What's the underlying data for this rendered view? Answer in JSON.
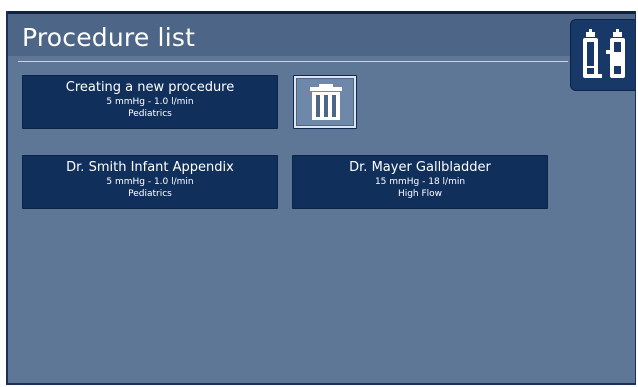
{
  "header": {
    "title": "Procedure list"
  },
  "side_tab": {
    "icon": "valve-toggle-icon"
  },
  "procedures": [
    {
      "name": "Creating a new procedure",
      "pressure_flow": "5 mmHg - 1.0 l/min",
      "mode": "Pediatrics"
    },
    {
      "name": "Dr. Smith Infant Appendix",
      "pressure_flow": "5 mmHg - 1.0 l/min",
      "mode": "Pediatrics"
    },
    {
      "name": "Dr. Mayer Gallbladder",
      "pressure_flow": "15 mmHg - 18 l/min",
      "mode": "High Flow"
    }
  ],
  "trash": {
    "icon": "trash-icon"
  },
  "colors": {
    "screen_bg": "#5e7797",
    "header_bg": "#4d6587",
    "button_bg": "#10305b",
    "frame": "#0e2149"
  }
}
